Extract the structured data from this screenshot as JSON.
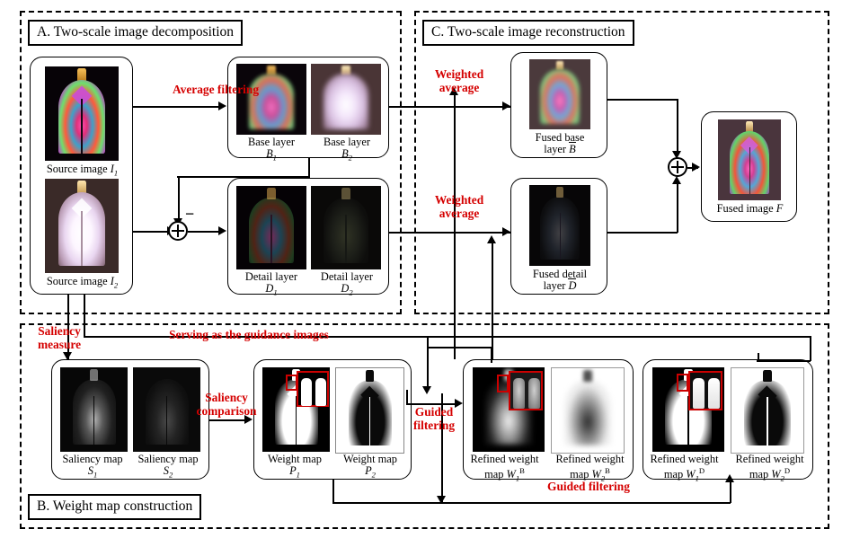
{
  "figure": {
    "type": "flow-diagram",
    "sections": [
      {
        "id": "A",
        "label": "A. Two-scale image decomposition"
      },
      {
        "id": "B",
        "label": "B. Weight map construction"
      },
      {
        "id": "C",
        "label": "C. Two-scale image reconstruction"
      }
    ],
    "accent_color": "#d50000",
    "line_color": "#000000",
    "inset_box_color": "#cc0000"
  },
  "nodes": {
    "source_images": {
      "caption1_text": "Source image",
      "caption1_sym": "I",
      "caption1_sub": "1",
      "caption2_text": "Source image",
      "caption2_sym": "I",
      "caption2_sub": "2"
    },
    "base_layers": {
      "caption_line1": "Base layer",
      "caption_line1b": "Base layer",
      "sym1": "B",
      "sub1": "1",
      "sym2": "B",
      "sub2": "2"
    },
    "detail_layers": {
      "caption_line1": "Detail layer",
      "caption_line1b": "Detail layer",
      "sym1": "D",
      "sub1": "1",
      "sym2": "D",
      "sub2": "2"
    },
    "fused_base": {
      "line1": "Fused base",
      "line2": "layer",
      "sym": "B"
    },
    "fused_detail": {
      "line1": "Fused detail",
      "line2": "layer",
      "sym": "D"
    },
    "fused_image": {
      "text": "Fused image",
      "sym": "F"
    },
    "saliency_maps": {
      "cap1": "Saliency map",
      "sym1": "S",
      "sub1": "1",
      "cap2": "Saliency map",
      "sym2": "S",
      "sub2": "2"
    },
    "weight_maps": {
      "cap1": "Weight map",
      "sym1": "P",
      "sub1": "1",
      "cap2": "Weight map",
      "sym2": "P",
      "sub2": "2"
    },
    "refined_weight_base": {
      "cap1a": "Refined weight",
      "cap1b": "map",
      "sym1": "W",
      "sub1": "1",
      "sup1": "B",
      "cap2a": "Refined weight",
      "cap2b": "map",
      "sym2": "W",
      "sub2": "2",
      "sup2": "B"
    },
    "refined_weight_detail": {
      "cap1a": "Refined weight",
      "cap1b": "map",
      "sym1": "W",
      "sub1": "1",
      "sup1": "D",
      "cap2a": "Refined weight",
      "cap2b": "map",
      "sym2": "W",
      "sub2": "2",
      "sup2": "D"
    }
  },
  "labels": {
    "average_filtering": "Average filtering",
    "weighted_average_top": "Weighted\naverage",
    "weighted_average_top_l1": "Weighted",
    "weighted_average_top_l2": "average",
    "weighted_average_bottom_l1": "Weighted",
    "weighted_average_bottom_l2": "average",
    "saliency_measure_l1": "Saliency",
    "saliency_measure_l2": "measure",
    "saliency_comparison_l1": "Saliency",
    "saliency_comparison_l2": "comparison",
    "serving_guidance": "Serving as the guidance images",
    "guided_filtering_l1": "Guided",
    "guided_filtering_l2": "filtering",
    "guided_filtering_bottom": "Guided filtering",
    "minus_sign": "−"
  }
}
